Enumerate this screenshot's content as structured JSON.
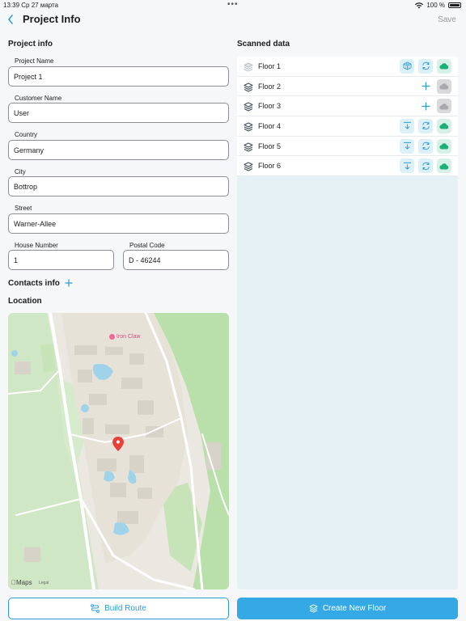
{
  "status": {
    "time": "13:39",
    "date": "Ср 27 марта",
    "battery": "100 %"
  },
  "nav": {
    "title": "Project Info",
    "save_label": "Save"
  },
  "project_info": {
    "title": "Project info",
    "fields": {
      "project_name": {
        "label": "Project Name",
        "value": "Project 1"
      },
      "customer_name": {
        "label": "Customer Name",
        "value": "User"
      },
      "country": {
        "label": "Country",
        "value": "Germany"
      },
      "city": {
        "label": "City",
        "value": "Bottrop"
      },
      "street": {
        "label": "Street",
        "value": "Warner-Allee"
      },
      "house_number": {
        "label": "House Number",
        "value": "1"
      },
      "postal_code": {
        "label": "Postal Code",
        "value": "D - 46244"
      }
    }
  },
  "contacts": {
    "label": "Contacts info"
  },
  "location": {
    "title": "Location",
    "map": {
      "poi": "Iron Claw",
      "attribution": "Maps",
      "legal": "Legal"
    }
  },
  "scanned": {
    "title": "Scanned data",
    "floors": [
      {
        "name": "Floor 1",
        "actions": [
          "cube",
          "sync",
          "cloud-green"
        ]
      },
      {
        "name": "Floor 2",
        "actions": [
          "add",
          "cloud-gray"
        ]
      },
      {
        "name": "Floor 3",
        "actions": [
          "add",
          "cloud-gray"
        ]
      },
      {
        "name": "Floor 4",
        "actions": [
          "download",
          "sync",
          "cloud-green"
        ]
      },
      {
        "name": "Floor 5",
        "actions": [
          "download",
          "sync",
          "cloud-green"
        ]
      },
      {
        "name": "Floor 6",
        "actions": [
          "download",
          "sync",
          "cloud-green"
        ]
      }
    ]
  },
  "buttons": {
    "build_route": "Build Route",
    "create_floor": "Create New Floor"
  },
  "colors": {
    "accent": "#2e9bd6",
    "green": "#1bb07a",
    "panel": "#e6f1f5"
  }
}
